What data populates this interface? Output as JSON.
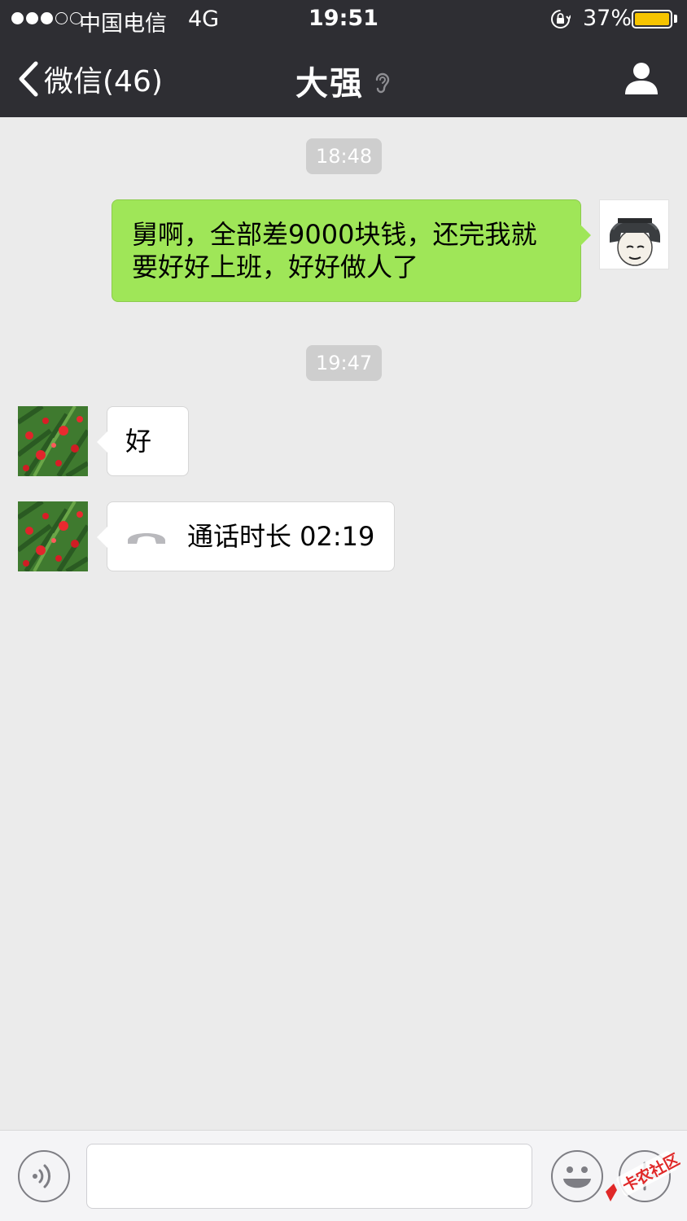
{
  "status_bar": {
    "carrier": "中国电信",
    "network": "4G",
    "time": "19:51",
    "battery_percent": "37%",
    "battery_level": 0.37,
    "signal_bars_filled": 3,
    "signal_bars_total": 5,
    "lock_icon": "orientation-lock-icon"
  },
  "nav": {
    "back_label": "微信(46)",
    "title": "大强",
    "title_icon": "earpiece-icon",
    "right_icon": "profile-icon"
  },
  "messages": [
    {
      "type": "time",
      "text": "18:48"
    },
    {
      "type": "text",
      "direction": "out",
      "text": "舅啊，全部差9000块钱，还完我就要好好上班，好好做人了"
    },
    {
      "type": "time",
      "text": "19:47"
    },
    {
      "type": "text",
      "direction": "in",
      "text": "好"
    },
    {
      "type": "call",
      "direction": "in",
      "text": "通话时长 02:19",
      "icon": "phone-hangup-icon"
    }
  ],
  "input_bar": {
    "voice_icon": "voice-input-icon",
    "emoji_icon": "emoji-icon",
    "more_icon": "add-more-icon",
    "watermark_text": "卡农社区"
  },
  "colors": {
    "nav_bg": "#2e2e33",
    "chat_bg": "#ebebeb",
    "outgoing_bubble": "#9fe658",
    "incoming_bubble": "#ffffff",
    "time_pill": "#cecece",
    "battery_fill": "#f6c400"
  }
}
